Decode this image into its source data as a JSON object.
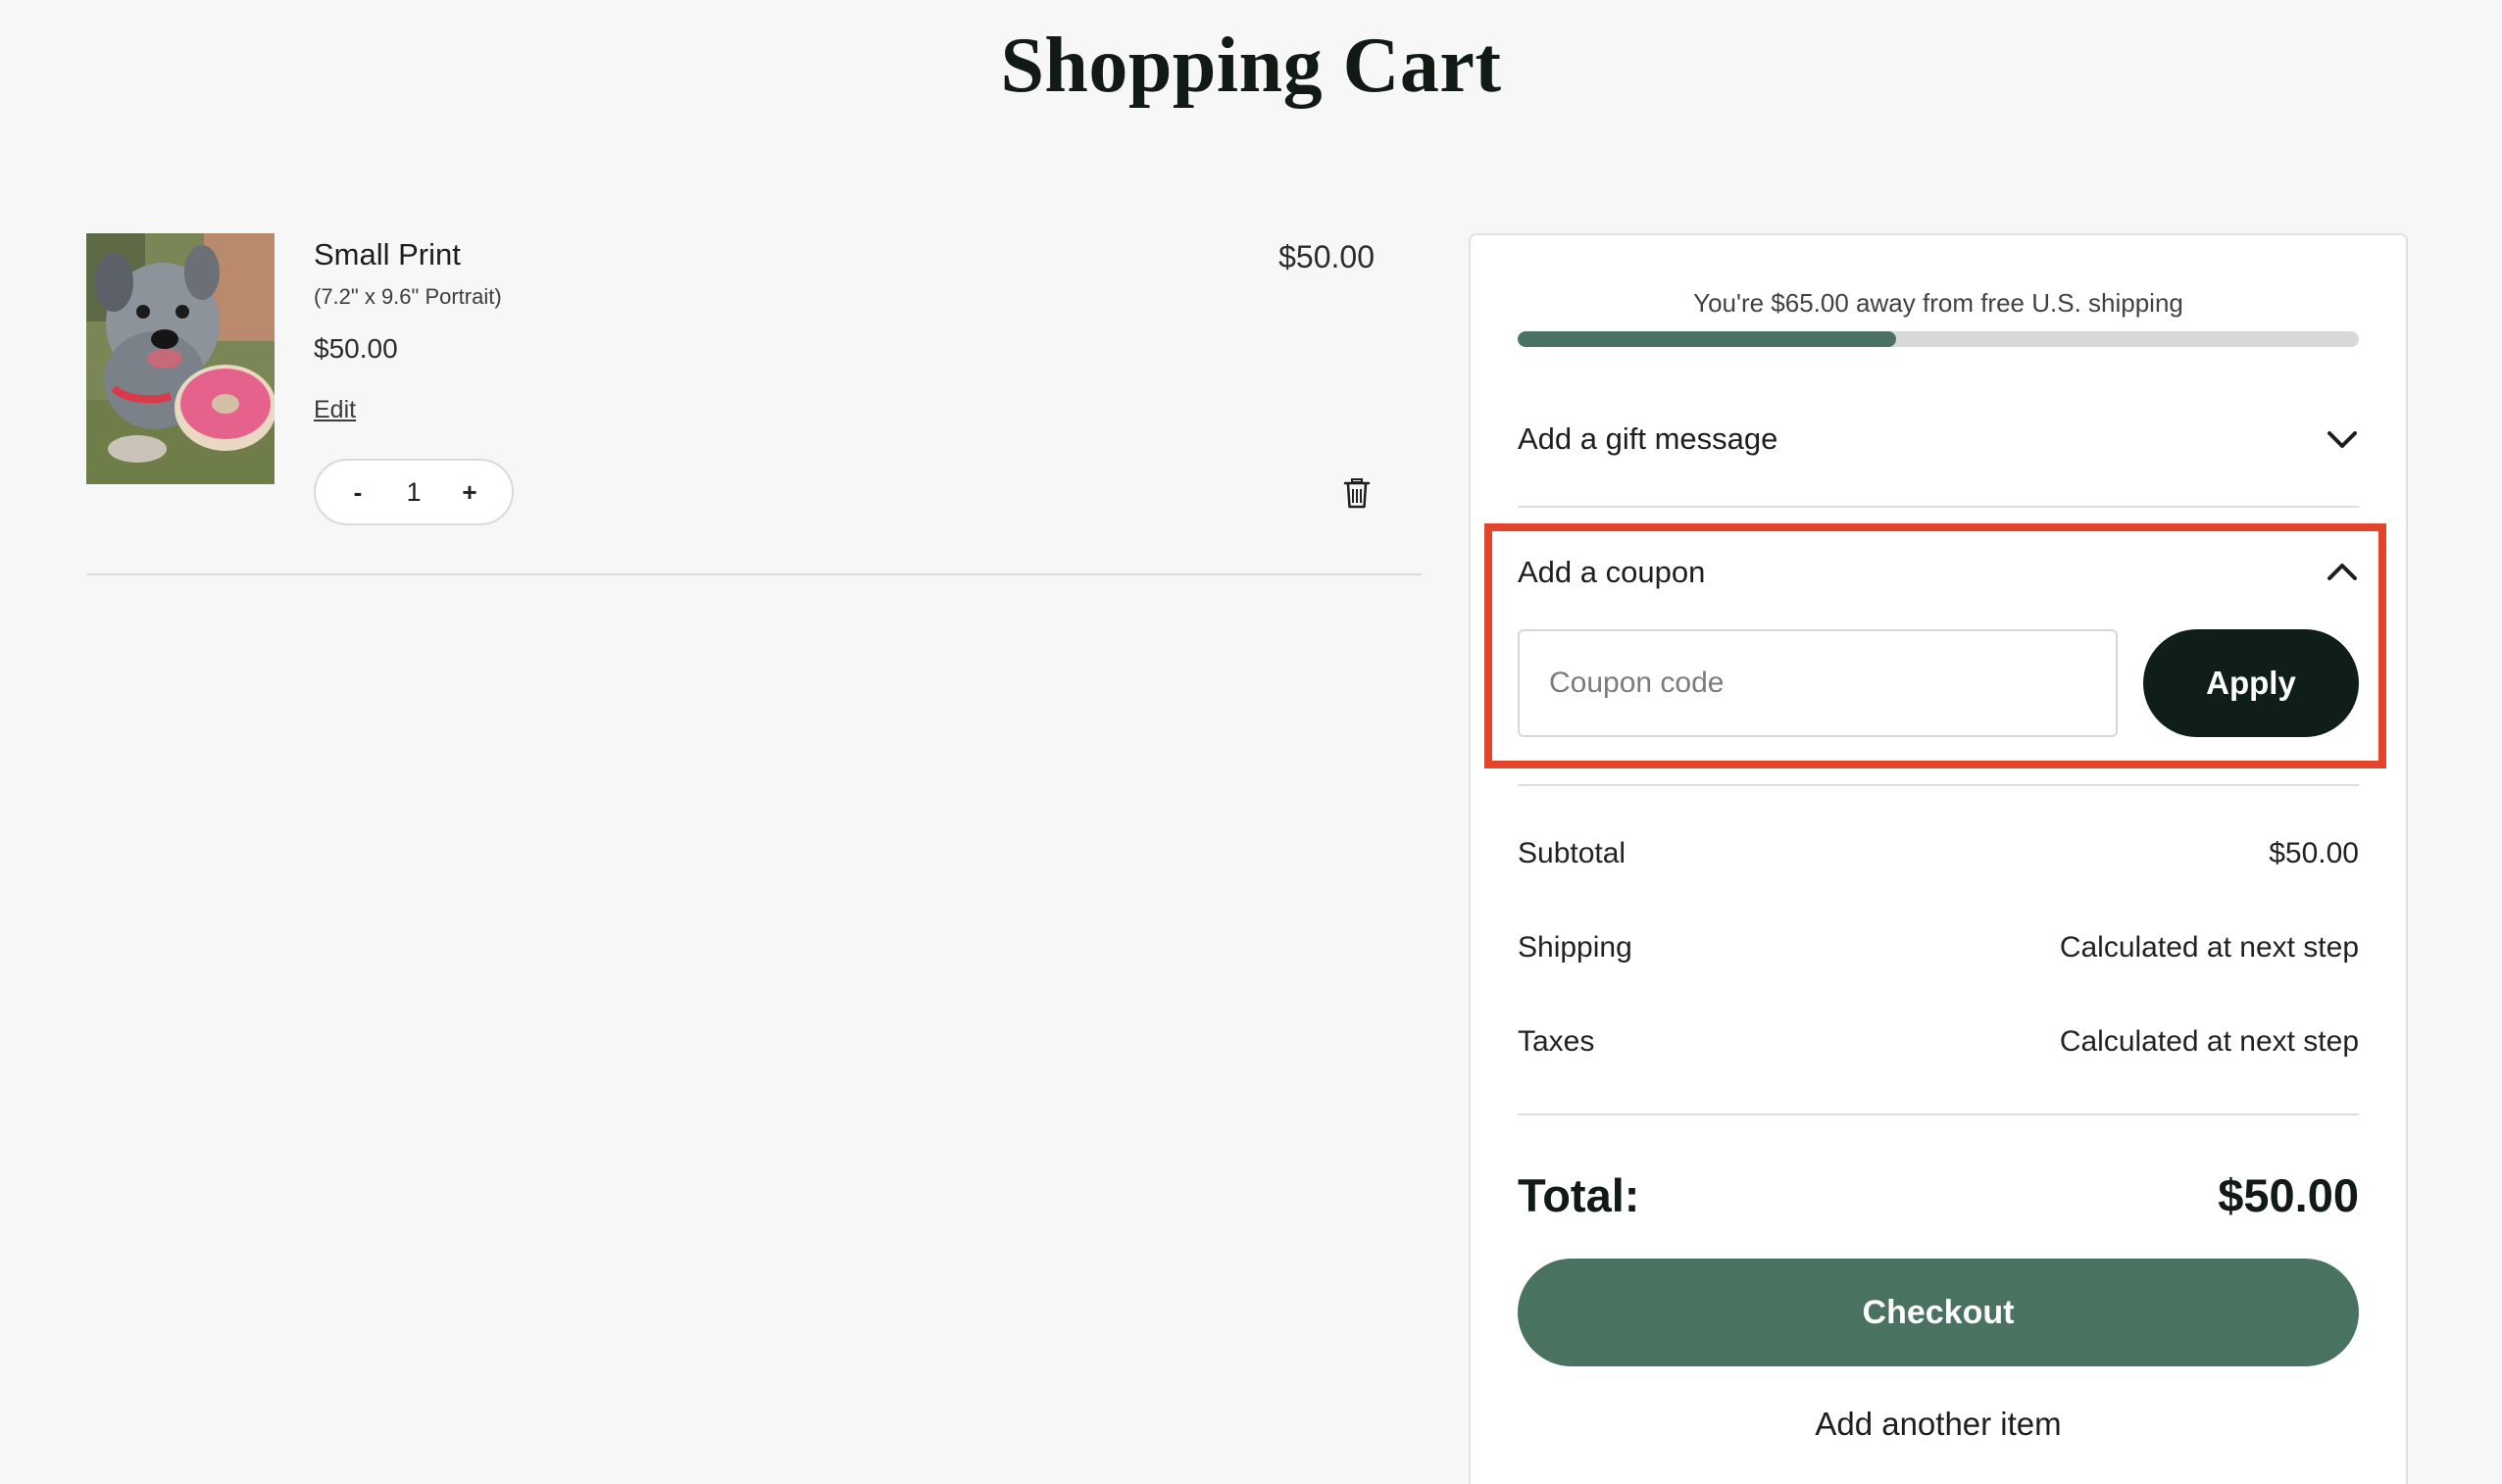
{
  "page": {
    "title": "Shopping Cart"
  },
  "cart": {
    "items": [
      {
        "name": "Small Print",
        "variant": "(7.2\" x 9.6\" Portrait)",
        "unit_price": "$50.00",
        "edit_label": "Edit",
        "quantity": "1",
        "qty_minus": "-",
        "qty_plus": "+",
        "line_price": "$50.00",
        "image_icon": "dog-photo",
        "remove_icon": "trash-icon"
      }
    ]
  },
  "summary": {
    "shipping_message": "You're $65.00 away from free U.S. shipping",
    "shipping_progress": 0.45,
    "gift": {
      "label": "Add a gift message",
      "icon": "chevron-down-icon"
    },
    "coupon": {
      "label": "Add a coupon",
      "icon": "chevron-up-icon",
      "placeholder": "Coupon code",
      "value": "",
      "apply_label": "Apply"
    },
    "lines": [
      {
        "label": "Subtotal",
        "value": "$50.00"
      },
      {
        "label": "Shipping",
        "value": "Calculated at next step"
      },
      {
        "label": "Taxes",
        "value": "Calculated at next step"
      }
    ],
    "total": {
      "label": "Total:",
      "value": "$50.00"
    },
    "checkout_label": "Checkout",
    "add_another_label": "Add another item"
  },
  "colors": {
    "accent_green": "#4a7260",
    "dark_button": "#0f1e18",
    "highlight": "#e2452b",
    "background": "#f6f7f6"
  }
}
